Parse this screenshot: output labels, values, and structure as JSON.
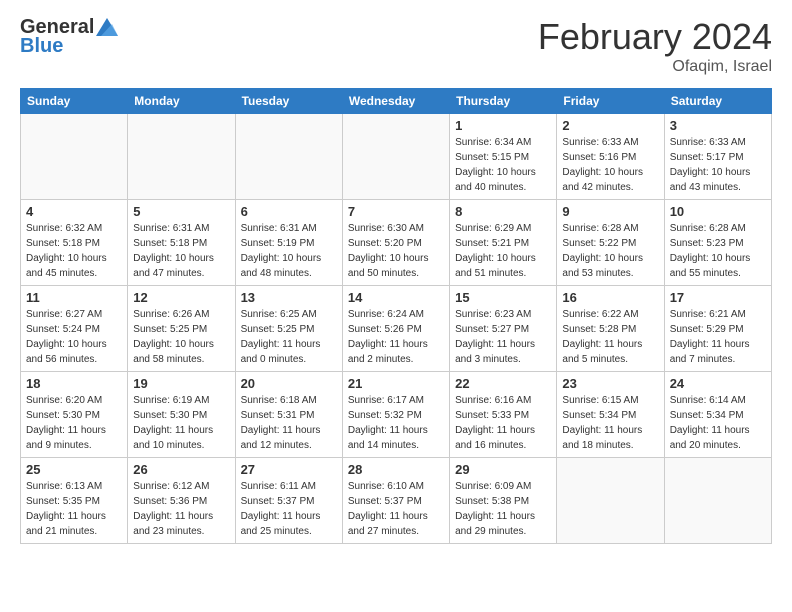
{
  "header": {
    "logo_line1": "General",
    "logo_line2": "Blue",
    "month": "February 2024",
    "location": "Ofaqim, Israel"
  },
  "weekdays": [
    "Sunday",
    "Monday",
    "Tuesday",
    "Wednesday",
    "Thursday",
    "Friday",
    "Saturday"
  ],
  "weeks": [
    [
      {
        "day": "",
        "info": ""
      },
      {
        "day": "",
        "info": ""
      },
      {
        "day": "",
        "info": ""
      },
      {
        "day": "",
        "info": ""
      },
      {
        "day": "1",
        "info": "Sunrise: 6:34 AM\nSunset: 5:15 PM\nDaylight: 10 hours\nand 40 minutes."
      },
      {
        "day": "2",
        "info": "Sunrise: 6:33 AM\nSunset: 5:16 PM\nDaylight: 10 hours\nand 42 minutes."
      },
      {
        "day": "3",
        "info": "Sunrise: 6:33 AM\nSunset: 5:17 PM\nDaylight: 10 hours\nand 43 minutes."
      }
    ],
    [
      {
        "day": "4",
        "info": "Sunrise: 6:32 AM\nSunset: 5:18 PM\nDaylight: 10 hours\nand 45 minutes."
      },
      {
        "day": "5",
        "info": "Sunrise: 6:31 AM\nSunset: 5:18 PM\nDaylight: 10 hours\nand 47 minutes."
      },
      {
        "day": "6",
        "info": "Sunrise: 6:31 AM\nSunset: 5:19 PM\nDaylight: 10 hours\nand 48 minutes."
      },
      {
        "day": "7",
        "info": "Sunrise: 6:30 AM\nSunset: 5:20 PM\nDaylight: 10 hours\nand 50 minutes."
      },
      {
        "day": "8",
        "info": "Sunrise: 6:29 AM\nSunset: 5:21 PM\nDaylight: 10 hours\nand 51 minutes."
      },
      {
        "day": "9",
        "info": "Sunrise: 6:28 AM\nSunset: 5:22 PM\nDaylight: 10 hours\nand 53 minutes."
      },
      {
        "day": "10",
        "info": "Sunrise: 6:28 AM\nSunset: 5:23 PM\nDaylight: 10 hours\nand 55 minutes."
      }
    ],
    [
      {
        "day": "11",
        "info": "Sunrise: 6:27 AM\nSunset: 5:24 PM\nDaylight: 10 hours\nand 56 minutes."
      },
      {
        "day": "12",
        "info": "Sunrise: 6:26 AM\nSunset: 5:25 PM\nDaylight: 10 hours\nand 58 minutes."
      },
      {
        "day": "13",
        "info": "Sunrise: 6:25 AM\nSunset: 5:25 PM\nDaylight: 11 hours\nand 0 minutes."
      },
      {
        "day": "14",
        "info": "Sunrise: 6:24 AM\nSunset: 5:26 PM\nDaylight: 11 hours\nand 2 minutes."
      },
      {
        "day": "15",
        "info": "Sunrise: 6:23 AM\nSunset: 5:27 PM\nDaylight: 11 hours\nand 3 minutes."
      },
      {
        "day": "16",
        "info": "Sunrise: 6:22 AM\nSunset: 5:28 PM\nDaylight: 11 hours\nand 5 minutes."
      },
      {
        "day": "17",
        "info": "Sunrise: 6:21 AM\nSunset: 5:29 PM\nDaylight: 11 hours\nand 7 minutes."
      }
    ],
    [
      {
        "day": "18",
        "info": "Sunrise: 6:20 AM\nSunset: 5:30 PM\nDaylight: 11 hours\nand 9 minutes."
      },
      {
        "day": "19",
        "info": "Sunrise: 6:19 AM\nSunset: 5:30 PM\nDaylight: 11 hours\nand 10 minutes."
      },
      {
        "day": "20",
        "info": "Sunrise: 6:18 AM\nSunset: 5:31 PM\nDaylight: 11 hours\nand 12 minutes."
      },
      {
        "day": "21",
        "info": "Sunrise: 6:17 AM\nSunset: 5:32 PM\nDaylight: 11 hours\nand 14 minutes."
      },
      {
        "day": "22",
        "info": "Sunrise: 6:16 AM\nSunset: 5:33 PM\nDaylight: 11 hours\nand 16 minutes."
      },
      {
        "day": "23",
        "info": "Sunrise: 6:15 AM\nSunset: 5:34 PM\nDaylight: 11 hours\nand 18 minutes."
      },
      {
        "day": "24",
        "info": "Sunrise: 6:14 AM\nSunset: 5:34 PM\nDaylight: 11 hours\nand 20 minutes."
      }
    ],
    [
      {
        "day": "25",
        "info": "Sunrise: 6:13 AM\nSunset: 5:35 PM\nDaylight: 11 hours\nand 21 minutes."
      },
      {
        "day": "26",
        "info": "Sunrise: 6:12 AM\nSunset: 5:36 PM\nDaylight: 11 hours\nand 23 minutes."
      },
      {
        "day": "27",
        "info": "Sunrise: 6:11 AM\nSunset: 5:37 PM\nDaylight: 11 hours\nand 25 minutes."
      },
      {
        "day": "28",
        "info": "Sunrise: 6:10 AM\nSunset: 5:37 PM\nDaylight: 11 hours\nand 27 minutes."
      },
      {
        "day": "29",
        "info": "Sunrise: 6:09 AM\nSunset: 5:38 PM\nDaylight: 11 hours\nand 29 minutes."
      },
      {
        "day": "",
        "info": ""
      },
      {
        "day": "",
        "info": ""
      }
    ]
  ]
}
